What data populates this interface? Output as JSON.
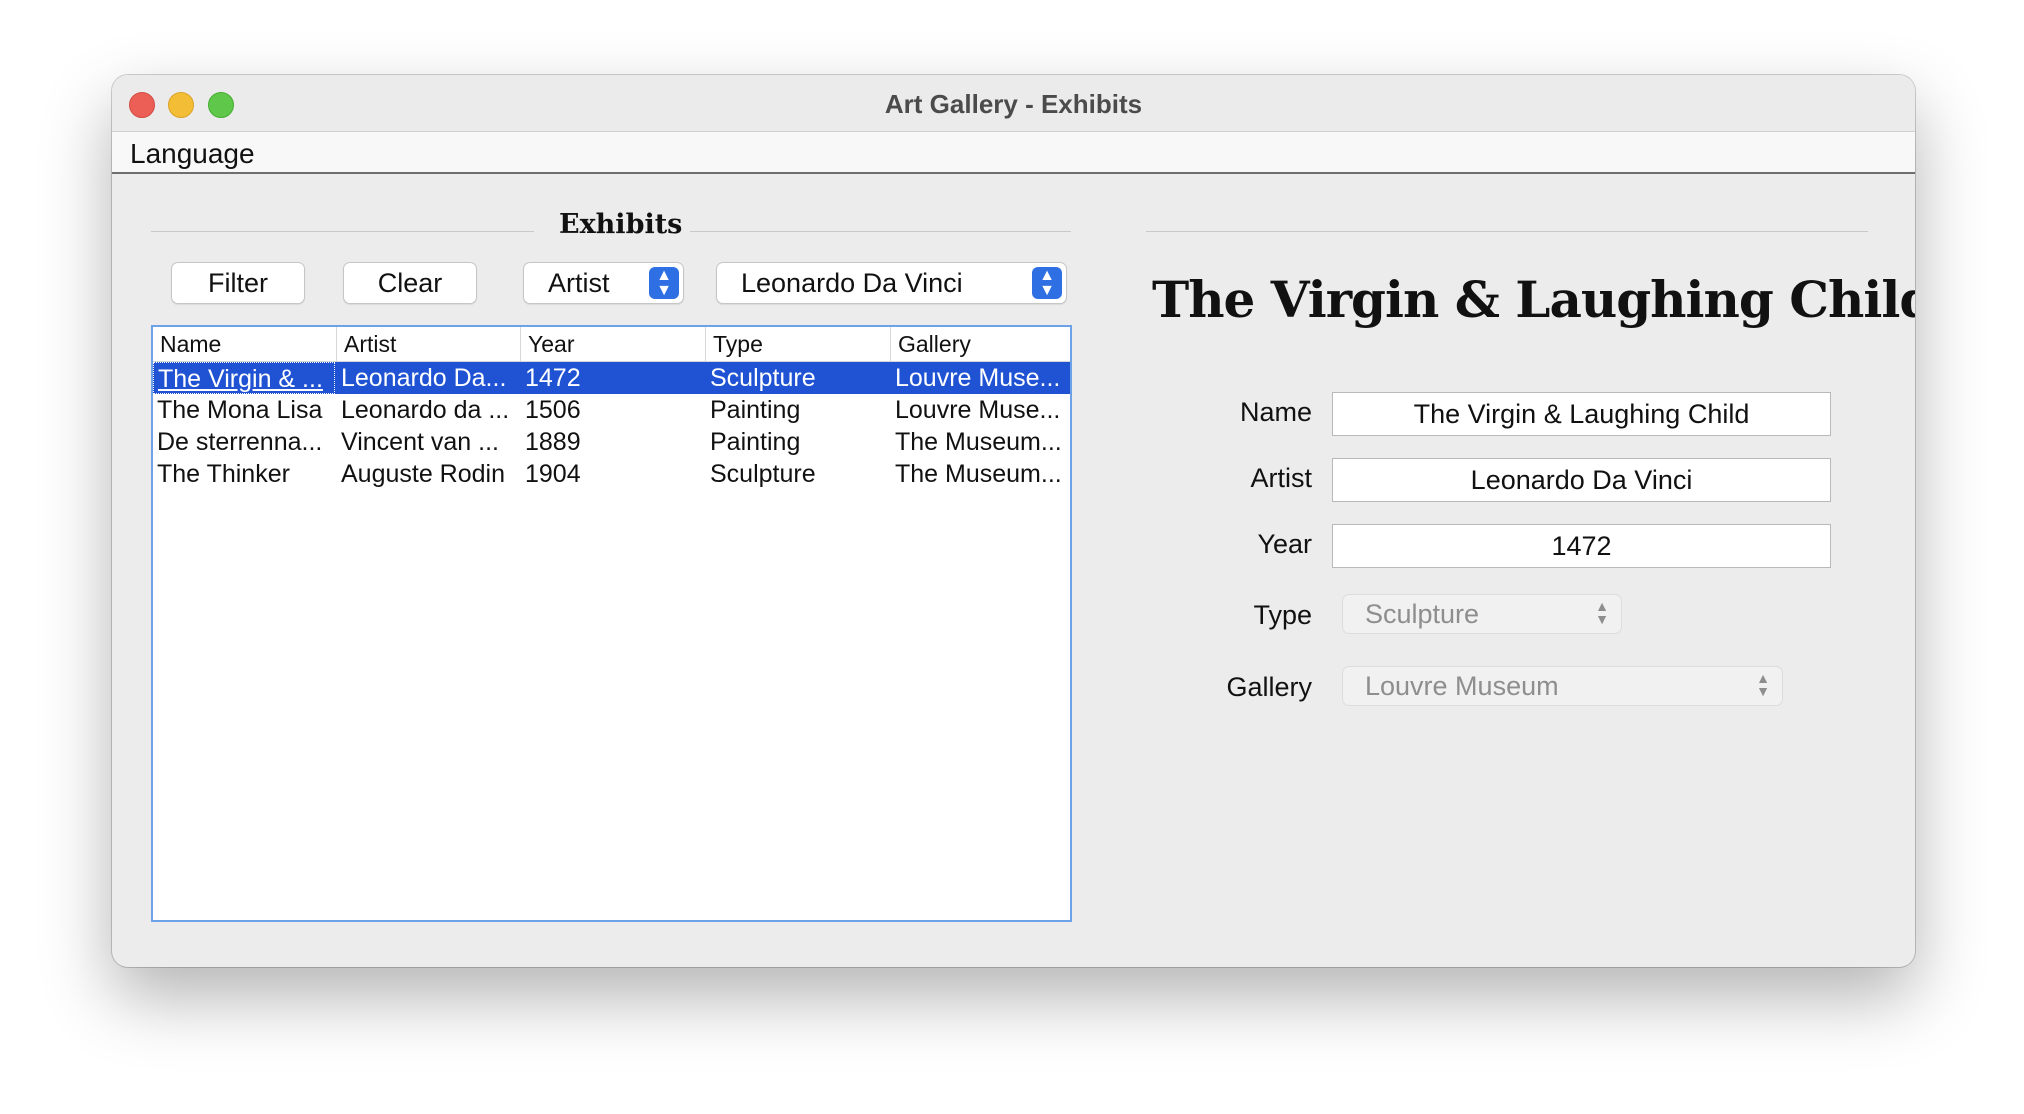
{
  "window": {
    "title": "Art Gallery - Exhibits"
  },
  "menubar": {
    "items": [
      "Language"
    ]
  },
  "exhibits": {
    "section_title": "Exhibits",
    "filter_label": "Filter",
    "clear_label": "Clear",
    "field_select": "Artist",
    "value_select": "Leonardo Da Vinci",
    "columns": [
      "Name",
      "Artist",
      "Year",
      "Type",
      "Gallery"
    ],
    "rows": [
      [
        "The Virgin & ...",
        "Leonardo Da...",
        "1472",
        "Sculpture",
        "Louvre Muse..."
      ],
      [
        "The Mona Lisa",
        "Leonardo da ...",
        "1506",
        "Painting",
        "Louvre Muse..."
      ],
      [
        "De sterrenna...",
        "Vincent van ...",
        "1889",
        "Painting",
        "The Museum..."
      ],
      [
        "The Thinker",
        "Auguste Rodin",
        "1904",
        "Sculpture",
        "The Museum..."
      ]
    ],
    "selected_row": 0
  },
  "detail": {
    "title": "The Virgin & Laughing Child",
    "name_label": "Name",
    "name_value": "The Virgin & Laughing Child",
    "artist_label": "Artist",
    "artist_value": "Leonardo Da Vinci",
    "year_label": "Year",
    "year_value": "1472",
    "type_label": "Type",
    "type_value": "Sculpture",
    "gallery_label": "Gallery",
    "gallery_value": "Louvre Museum"
  },
  "colors": {
    "selection": "#1f53d4",
    "accent": "#2f6fe4"
  }
}
